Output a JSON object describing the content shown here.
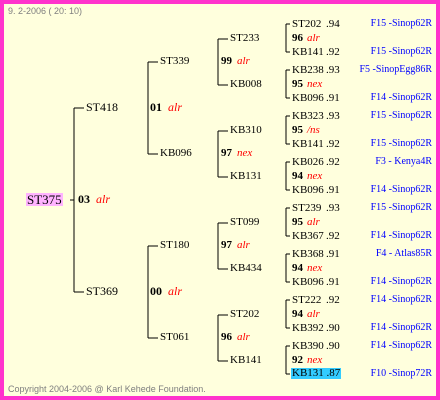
{
  "header": {
    "date": "9.  2-2006 ( 20: 10)"
  },
  "footer": {
    "copyright": "Copyright 2004-2006 @ Karl Kehede Foundation."
  },
  "root": {
    "name": "ST375",
    "num": "03",
    "rank": "alr"
  },
  "gen1": [
    {
      "name": "ST418",
      "num": "01",
      "rank": "alr"
    },
    {
      "name": "ST369",
      "num": "00",
      "rank": "alr"
    }
  ],
  "gen2": [
    {
      "name": "ST339",
      "num": "99",
      "rank": "alr"
    },
    {
      "name": "KB096",
      "num": "97",
      "rank": "nex"
    },
    {
      "name": "ST180",
      "num": "97",
      "rank": "alr"
    },
    {
      "name": "ST061",
      "num": "96",
      "rank": "alr"
    }
  ],
  "gen3": [
    {
      "name": "ST233",
      "num": "96",
      "rank": "alr"
    },
    {
      "name": "KB008",
      "num": "95",
      "rank": "nex"
    },
    {
      "name": "KB310",
      "num": "95",
      "rank": "/ns"
    },
    {
      "name": "KB131",
      "num": "94",
      "rank": "nex"
    },
    {
      "name": "ST099",
      "num": "95",
      "rank": "alr"
    },
    {
      "name": "KB434",
      "num": "94",
      "rank": "nex"
    },
    {
      "name": "ST202",
      "num": "94",
      "rank": "alr"
    },
    {
      "name": "KB141",
      "num": "92",
      "rank": "nex"
    }
  ],
  "gen4": [
    {
      "name": "ST202",
      "score": ".94",
      "info": "F15 -Sinop62R"
    },
    {
      "name": "KB141",
      "score": ".92",
      "info": "F15 -Sinop62R"
    },
    {
      "name": "KB238",
      "score": ".93",
      "info": "F5 -SinopEgg86R"
    },
    {
      "name": "KB096",
      "score": ".91",
      "info": "F14 -Sinop62R"
    },
    {
      "name": "KB323",
      "score": ".93",
      "info": "F15 -Sinop62R"
    },
    {
      "name": "KB141",
      "score": ".92",
      "info": "F15 -Sinop62R"
    },
    {
      "name": "KB026",
      "score": ".92",
      "info": "F3 - Kenya4R"
    },
    {
      "name": "KB096",
      "score": ".91",
      "info": "F14 -Sinop62R"
    },
    {
      "name": "ST239",
      "score": ".93",
      "info": "F15 -Sinop62R"
    },
    {
      "name": "KB367",
      "score": ".92",
      "info": "F14 -Sinop62R"
    },
    {
      "name": "KB368",
      "score": ".91",
      "info": "F4 - Atlas85R"
    },
    {
      "name": "KB096",
      "score": ".91",
      "info": "F14 -Sinop62R"
    },
    {
      "name": "ST222",
      "score": ".92",
      "info": "F14 -Sinop62R"
    },
    {
      "name": "KB392",
      "score": ".90",
      "info": "F14 -Sinop62R"
    },
    {
      "name": "KB390",
      "score": ".90",
      "info": "F14 -Sinop62R"
    },
    {
      "name": "KB131",
      "score": ".87",
      "info": "F10 -Sinop72R"
    }
  ],
  "colors": {
    "border": "#ff33cc",
    "background": "#ffffdd",
    "rank": "#ff0000",
    "info": "#0000ff",
    "root_highlight": "#ffb3ff",
    "leaf_highlight": "#33ccff"
  }
}
